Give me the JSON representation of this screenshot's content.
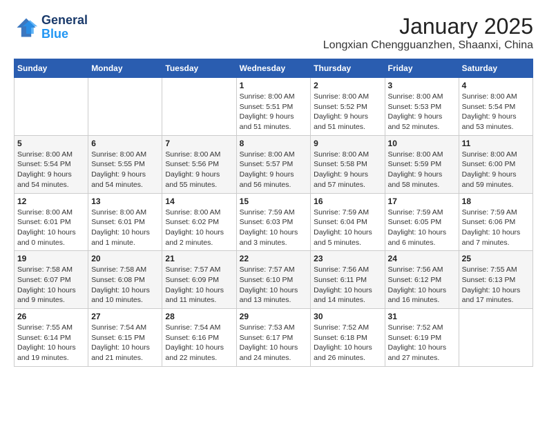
{
  "header": {
    "logo_line1": "General",
    "logo_line2": "Blue",
    "title": "January 2025",
    "subtitle": "Longxian Chengguanzhen, Shaanxi, China"
  },
  "calendar": {
    "days_of_week": [
      "Sunday",
      "Monday",
      "Tuesday",
      "Wednesday",
      "Thursday",
      "Friday",
      "Saturday"
    ],
    "weeks": [
      [
        {
          "day": "",
          "info": ""
        },
        {
          "day": "",
          "info": ""
        },
        {
          "day": "",
          "info": ""
        },
        {
          "day": "1",
          "info": "Sunrise: 8:00 AM\nSunset: 5:51 PM\nDaylight: 9 hours\nand 51 minutes."
        },
        {
          "day": "2",
          "info": "Sunrise: 8:00 AM\nSunset: 5:52 PM\nDaylight: 9 hours\nand 51 minutes."
        },
        {
          "day": "3",
          "info": "Sunrise: 8:00 AM\nSunset: 5:53 PM\nDaylight: 9 hours\nand 52 minutes."
        },
        {
          "day": "4",
          "info": "Sunrise: 8:00 AM\nSunset: 5:54 PM\nDaylight: 9 hours\nand 53 minutes."
        }
      ],
      [
        {
          "day": "5",
          "info": "Sunrise: 8:00 AM\nSunset: 5:54 PM\nDaylight: 9 hours\nand 54 minutes."
        },
        {
          "day": "6",
          "info": "Sunrise: 8:00 AM\nSunset: 5:55 PM\nDaylight: 9 hours\nand 54 minutes."
        },
        {
          "day": "7",
          "info": "Sunrise: 8:00 AM\nSunset: 5:56 PM\nDaylight: 9 hours\nand 55 minutes."
        },
        {
          "day": "8",
          "info": "Sunrise: 8:00 AM\nSunset: 5:57 PM\nDaylight: 9 hours\nand 56 minutes."
        },
        {
          "day": "9",
          "info": "Sunrise: 8:00 AM\nSunset: 5:58 PM\nDaylight: 9 hours\nand 57 minutes."
        },
        {
          "day": "10",
          "info": "Sunrise: 8:00 AM\nSunset: 5:59 PM\nDaylight: 9 hours\nand 58 minutes."
        },
        {
          "day": "11",
          "info": "Sunrise: 8:00 AM\nSunset: 6:00 PM\nDaylight: 9 hours\nand 59 minutes."
        }
      ],
      [
        {
          "day": "12",
          "info": "Sunrise: 8:00 AM\nSunset: 6:01 PM\nDaylight: 10 hours\nand 0 minutes."
        },
        {
          "day": "13",
          "info": "Sunrise: 8:00 AM\nSunset: 6:01 PM\nDaylight: 10 hours\nand 1 minute."
        },
        {
          "day": "14",
          "info": "Sunrise: 8:00 AM\nSunset: 6:02 PM\nDaylight: 10 hours\nand 2 minutes."
        },
        {
          "day": "15",
          "info": "Sunrise: 7:59 AM\nSunset: 6:03 PM\nDaylight: 10 hours\nand 3 minutes."
        },
        {
          "day": "16",
          "info": "Sunrise: 7:59 AM\nSunset: 6:04 PM\nDaylight: 10 hours\nand 5 minutes."
        },
        {
          "day": "17",
          "info": "Sunrise: 7:59 AM\nSunset: 6:05 PM\nDaylight: 10 hours\nand 6 minutes."
        },
        {
          "day": "18",
          "info": "Sunrise: 7:59 AM\nSunset: 6:06 PM\nDaylight: 10 hours\nand 7 minutes."
        }
      ],
      [
        {
          "day": "19",
          "info": "Sunrise: 7:58 AM\nSunset: 6:07 PM\nDaylight: 10 hours\nand 9 minutes."
        },
        {
          "day": "20",
          "info": "Sunrise: 7:58 AM\nSunset: 6:08 PM\nDaylight: 10 hours\nand 10 minutes."
        },
        {
          "day": "21",
          "info": "Sunrise: 7:57 AM\nSunset: 6:09 PM\nDaylight: 10 hours\nand 11 minutes."
        },
        {
          "day": "22",
          "info": "Sunrise: 7:57 AM\nSunset: 6:10 PM\nDaylight: 10 hours\nand 13 minutes."
        },
        {
          "day": "23",
          "info": "Sunrise: 7:56 AM\nSunset: 6:11 PM\nDaylight: 10 hours\nand 14 minutes."
        },
        {
          "day": "24",
          "info": "Sunrise: 7:56 AM\nSunset: 6:12 PM\nDaylight: 10 hours\nand 16 minutes."
        },
        {
          "day": "25",
          "info": "Sunrise: 7:55 AM\nSunset: 6:13 PM\nDaylight: 10 hours\nand 17 minutes."
        }
      ],
      [
        {
          "day": "26",
          "info": "Sunrise: 7:55 AM\nSunset: 6:14 PM\nDaylight: 10 hours\nand 19 minutes."
        },
        {
          "day": "27",
          "info": "Sunrise: 7:54 AM\nSunset: 6:15 PM\nDaylight: 10 hours\nand 21 minutes."
        },
        {
          "day": "28",
          "info": "Sunrise: 7:54 AM\nSunset: 6:16 PM\nDaylight: 10 hours\nand 22 minutes."
        },
        {
          "day": "29",
          "info": "Sunrise: 7:53 AM\nSunset: 6:17 PM\nDaylight: 10 hours\nand 24 minutes."
        },
        {
          "day": "30",
          "info": "Sunrise: 7:52 AM\nSunset: 6:18 PM\nDaylight: 10 hours\nand 26 minutes."
        },
        {
          "day": "31",
          "info": "Sunrise: 7:52 AM\nSunset: 6:19 PM\nDaylight: 10 hours\nand 27 minutes."
        },
        {
          "day": "",
          "info": ""
        }
      ]
    ]
  }
}
